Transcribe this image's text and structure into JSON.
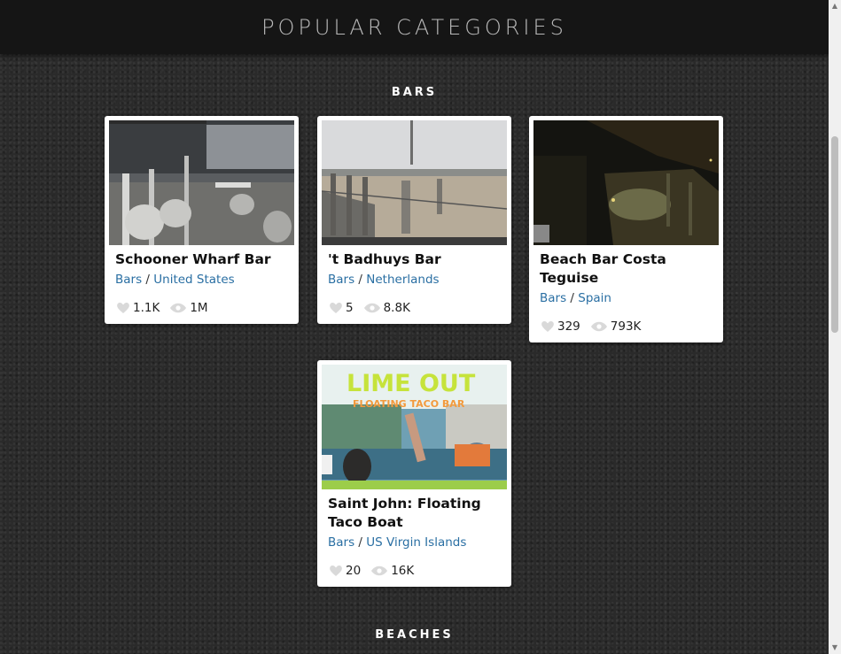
{
  "header": {
    "title": "POPULAR CATEGORIES"
  },
  "sections": [
    {
      "title": "BARS"
    },
    {
      "title": "BEACHES"
    }
  ],
  "cards": [
    {
      "title": "Schooner Wharf Bar",
      "category": "Bars",
      "location": "United States",
      "likes": "1.1K",
      "views": "1M"
    },
    {
      "title": "'t Badhuys Bar",
      "category": "Bars",
      "location": "Netherlands",
      "likes": "5",
      "views": "8.8K"
    },
    {
      "title": "Beach Bar Costa Teguise",
      "category": "Bars",
      "location": "Spain",
      "likes": "329",
      "views": "793K"
    },
    {
      "title": "Saint John: Floating Taco Boat",
      "category": "Bars",
      "location": "US Virgin Islands",
      "likes": "20",
      "views": "16K"
    }
  ],
  "thumbnails": {
    "taco_sign_line1": "LIME OUT",
    "taco_sign_line2": "FLOATING TACO BAR"
  },
  "colors": {
    "link": "#2a6fa3",
    "header_bg": "#151515",
    "page_bg": "#2a2a2a"
  }
}
